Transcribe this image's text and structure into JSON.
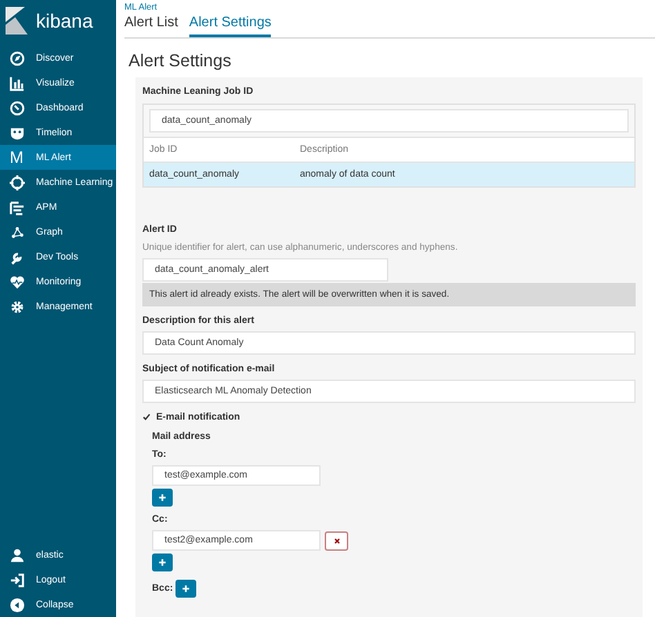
{
  "brand": {
    "name": "kibana"
  },
  "sidebar": {
    "items": [
      {
        "label": "Discover",
        "selected": false
      },
      {
        "label": "Visualize",
        "selected": false
      },
      {
        "label": "Dashboard",
        "selected": false
      },
      {
        "label": "Timelion",
        "selected": false
      },
      {
        "label": "ML Alert",
        "glyph": "M",
        "selected": true
      },
      {
        "label": "Machine Learning",
        "selected": false
      },
      {
        "label": "APM",
        "selected": false
      },
      {
        "label": "Graph",
        "selected": false
      },
      {
        "label": "Dev Tools",
        "selected": false
      },
      {
        "label": "Monitoring",
        "selected": false
      },
      {
        "label": "Management",
        "selected": false
      }
    ],
    "footer_items": [
      {
        "label": "elastic"
      },
      {
        "label": "Logout"
      },
      {
        "label": "Collapse"
      }
    ]
  },
  "breadcrumb": "ML Alert",
  "tabs": [
    {
      "label": "Alert List",
      "selected": false
    },
    {
      "label": "Alert Settings",
      "selected": true
    }
  ],
  "heading": "Alert Settings",
  "job": {
    "label": "Machine Leaning Job ID",
    "search_value": "data_count_anomaly",
    "columns": [
      "Job ID",
      "Description"
    ],
    "rows": [
      {
        "cells": [
          "data_count_anomaly",
          "anomaly of data count"
        ],
        "selected": true
      }
    ]
  },
  "alert_id": {
    "label": "Alert ID",
    "hint": "Unique identifier for alert, can use alphanumeric, underscores and hyphens.",
    "value": "data_count_anomaly_alert",
    "warning": "This alert id already exists. The alert will be overwritten when it is saved."
  },
  "description": {
    "label": "Description for this alert",
    "value": "Data Count Anomaly"
  },
  "subject": {
    "label": "Subject of notification e-mail",
    "value": "Elasticsearch ML Anomaly Detection"
  },
  "email": {
    "label": "E-mail notification",
    "checked": true,
    "section_title": "Mail address",
    "recipients": [
      {
        "label": "To:",
        "addresses": [
          {
            "value": "test@example.com",
            "removable": false
          }
        ]
      },
      {
        "label": "Cc:",
        "addresses": [
          {
            "value": "test2@example.com",
            "removable": true
          }
        ]
      },
      {
        "label": "Bcc:"
      }
    ]
  }
}
